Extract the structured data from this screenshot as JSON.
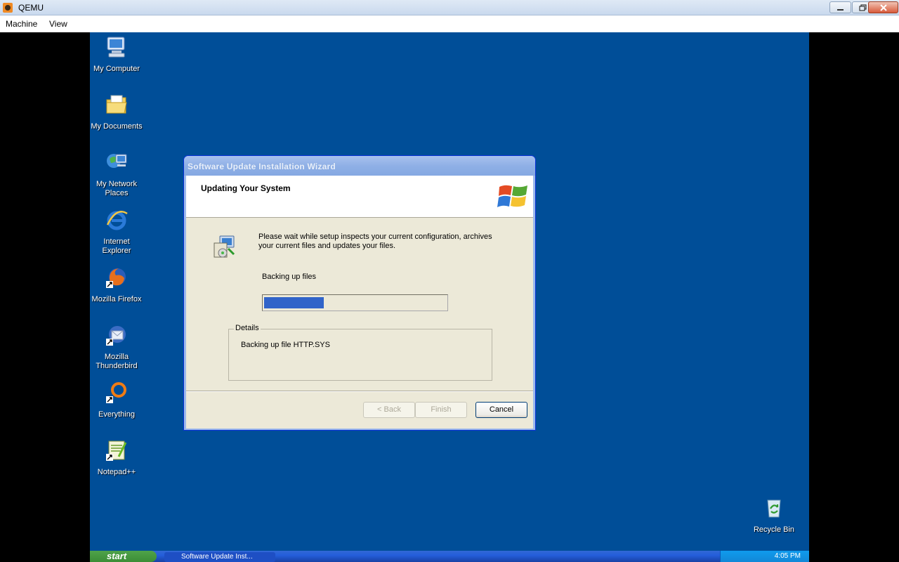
{
  "host": {
    "title": "QEMU",
    "menu": [
      "Machine",
      "View"
    ]
  },
  "desktop": {
    "icons": [
      {
        "label": "My Computer",
        "icon": "my-computer-icon"
      },
      {
        "label": "My Documents",
        "icon": "my-documents-icon"
      },
      {
        "label": "My Network\nPlaces",
        "icon": "network-places-icon"
      },
      {
        "label": "Internet\nExplorer",
        "icon": "internet-explorer-icon"
      },
      {
        "label": "Mozilla Firefox",
        "icon": "firefox-icon"
      },
      {
        "label": "Mozilla\nThunderbird",
        "icon": "thunderbird-icon"
      },
      {
        "label": "Everything",
        "icon": "everything-icon"
      },
      {
        "label": "Notepad++",
        "icon": "notepadpp-icon"
      },
      {
        "label": "Recycle Bin",
        "icon": "recycle-bin-icon"
      }
    ]
  },
  "wizard": {
    "title": "Software Update Installation Wizard",
    "heading": "Updating Your System",
    "description": "Please wait while setup inspects your current configuration, archives your current files and updates your files.",
    "status": "Backing up files",
    "progress": 0.33,
    "details_legend": "Details",
    "details_text": "Backing up file HTTP.SYS",
    "buttons": {
      "back": "< Back",
      "finish": "Finish",
      "cancel": "Cancel"
    }
  },
  "taskbar": {
    "start_label": "start",
    "task_label": "Software Update Inst...",
    "clock": "4:05 PM"
  },
  "colors": {
    "desktop_bg": "#004e98",
    "progress_fill": "#3164c9",
    "dialog_bg": "#ece9d8"
  }
}
